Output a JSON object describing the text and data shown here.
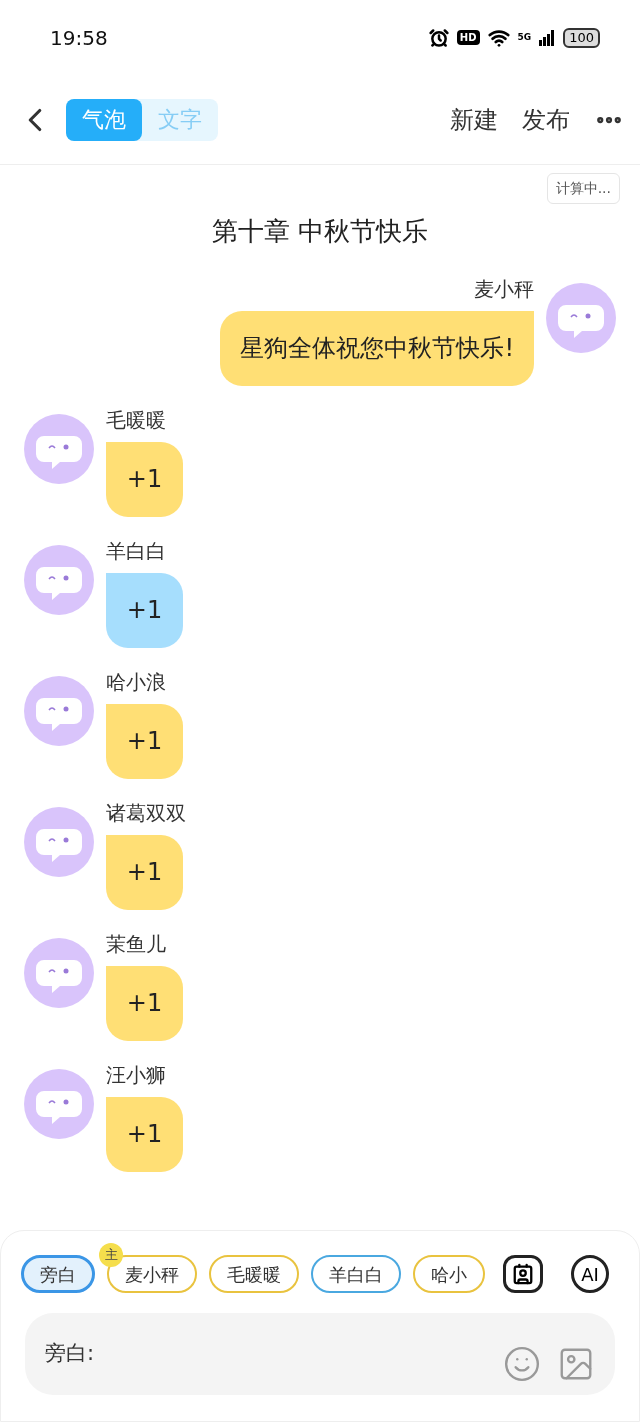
{
  "status_bar": {
    "time": "19:58",
    "battery": "100",
    "network": "5G",
    "hd_label": "HD"
  },
  "header": {
    "tabs": [
      {
        "label": "气泡",
        "selected": true
      },
      {
        "label": "文字",
        "selected": false
      }
    ],
    "actions": [
      "新建",
      "发布"
    ]
  },
  "status_badge": "计算中...",
  "chapter_title": "第十章 中秋节快乐",
  "messages": [
    {
      "name": "麦小秤",
      "text": "星狗全体祝您中秋节快乐!",
      "kind": "outgoing",
      "color": "#ffdf75"
    },
    {
      "name": "毛暖暖",
      "text": "+1",
      "kind": "incoming",
      "color": "#ffdf75"
    },
    {
      "name": "羊白白",
      "text": "+1",
      "kind": "incoming",
      "color": "#a6defd"
    },
    {
      "name": "哈小浪",
      "text": "+1",
      "kind": "incoming",
      "color": "#ffdf75"
    },
    {
      "name": "诸葛双双",
      "text": "+1",
      "kind": "incoming",
      "color": "#ffdf75"
    },
    {
      "name": "茉鱼儿",
      "text": "+1",
      "kind": "incoming",
      "color": "#ffdf75"
    },
    {
      "name": "汪小狮",
      "text": "+1",
      "kind": "incoming",
      "color": "#ffdf75"
    }
  ],
  "role_chips": [
    {
      "label": "旁白",
      "selected": true,
      "color": "#3b96e6"
    },
    {
      "label": "麦小秤",
      "selected": false,
      "color": "#e9c33f",
      "badge": "主"
    },
    {
      "label": "毛暖暖",
      "selected": false,
      "color": "#e9c33f"
    },
    {
      "label": "羊白白",
      "selected": false,
      "color": "#4aa8e0"
    },
    {
      "label": "哈小",
      "selected": false,
      "color": "#e9c33f"
    }
  ],
  "ai_button": "AI",
  "input": {
    "label": "旁白:"
  }
}
